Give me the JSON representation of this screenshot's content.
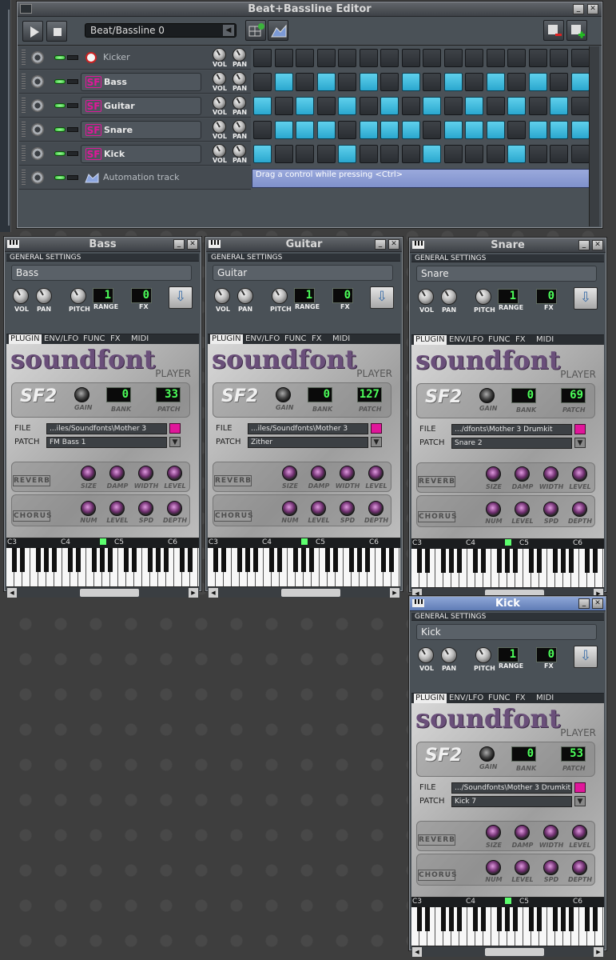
{
  "bb_editor": {
    "title": "Beat+Bassline Editor",
    "pattern_select": "Beat/Bassline 0",
    "tracks": [
      {
        "name": "Kicker",
        "style": "plain",
        "steps": [
          0,
          0,
          0,
          0,
          0,
          0,
          0,
          0,
          0,
          0,
          0,
          0,
          0,
          0,
          0,
          0
        ]
      },
      {
        "name": "Bass",
        "style": "sf2",
        "steps": [
          0,
          1,
          0,
          1,
          0,
          1,
          0,
          1,
          0,
          1,
          0,
          1,
          0,
          1,
          0,
          1
        ]
      },
      {
        "name": "Guitar",
        "style": "sf2",
        "steps": [
          1,
          0,
          1,
          0,
          1,
          0,
          1,
          0,
          1,
          0,
          1,
          0,
          1,
          0,
          1,
          0
        ]
      },
      {
        "name": "Snare",
        "style": "sf2",
        "steps": [
          0,
          1,
          1,
          1,
          0,
          1,
          1,
          1,
          0,
          1,
          1,
          1,
          0,
          1,
          1,
          1
        ]
      },
      {
        "name": "Kick",
        "style": "sf2",
        "steps": [
          1,
          0,
          0,
          0,
          1,
          0,
          0,
          0,
          1,
          0,
          0,
          0,
          1,
          0,
          0,
          0
        ]
      }
    ],
    "automation": {
      "name": "Automation track",
      "hint": "Drag a control while pressing <Ctrl>"
    },
    "knob_vol": "VOL",
    "knob_pan": "PAN"
  },
  "common": {
    "general_settings": "GENERAL SETTINGS",
    "vol": "VOL",
    "pan": "PAN",
    "pitch": "PITCH",
    "range": "RANGE",
    "fx": "FX",
    "tabs": [
      "PLUGIN",
      "ENV/LFO",
      "FUNC",
      "FX",
      "MIDI"
    ],
    "logo": "soundfont",
    "player": "PLAYER",
    "sf2": "SF2",
    "gain": "GAIN",
    "bank": "BANK",
    "patch": "PATCH",
    "file_label": "FILE",
    "patch_label": "PATCH",
    "reverb": "REVERB",
    "chorus": "CHORUS",
    "reverb_knobs": [
      "SIZE",
      "DAMP",
      "WIDTH",
      "LEVEL"
    ],
    "chorus_knobs": [
      "NUM",
      "LEVEL",
      "SPD",
      "DEPTH"
    ],
    "octaves": [
      "C3",
      "C4",
      "C5",
      "C6"
    ]
  },
  "instruments": [
    {
      "title": "Bass",
      "name": "Bass",
      "range": "1",
      "fx": "0",
      "bank": "0",
      "patch": "33",
      "file": "...iles/Soundfonts\\Mother 3",
      "patch_name": "FM Bass 1"
    },
    {
      "title": "Guitar",
      "name": "Guitar",
      "range": "1",
      "fx": "0",
      "bank": "0",
      "patch": "127",
      "file": "...iles/Soundfonts\\Mother 3",
      "patch_name": "Zither"
    },
    {
      "title": "Snare",
      "name": "Snare",
      "range": "1",
      "fx": "0",
      "bank": "0",
      "patch": "69",
      "file": ".../dfonts\\Mother 3 Drumkit",
      "patch_name": "Snare 2"
    },
    {
      "title": "Kick",
      "name": "Kick",
      "range": "1",
      "fx": "0",
      "bank": "0",
      "patch": "53",
      "file": ".../Soundfonts\\Mother 3 Drumkit",
      "patch_name": "Kick 7"
    }
  ],
  "colors": {
    "step_on": "#3cc0e4",
    "accent_pink": "#e0169a",
    "lcd_green": "#4cff5a"
  }
}
